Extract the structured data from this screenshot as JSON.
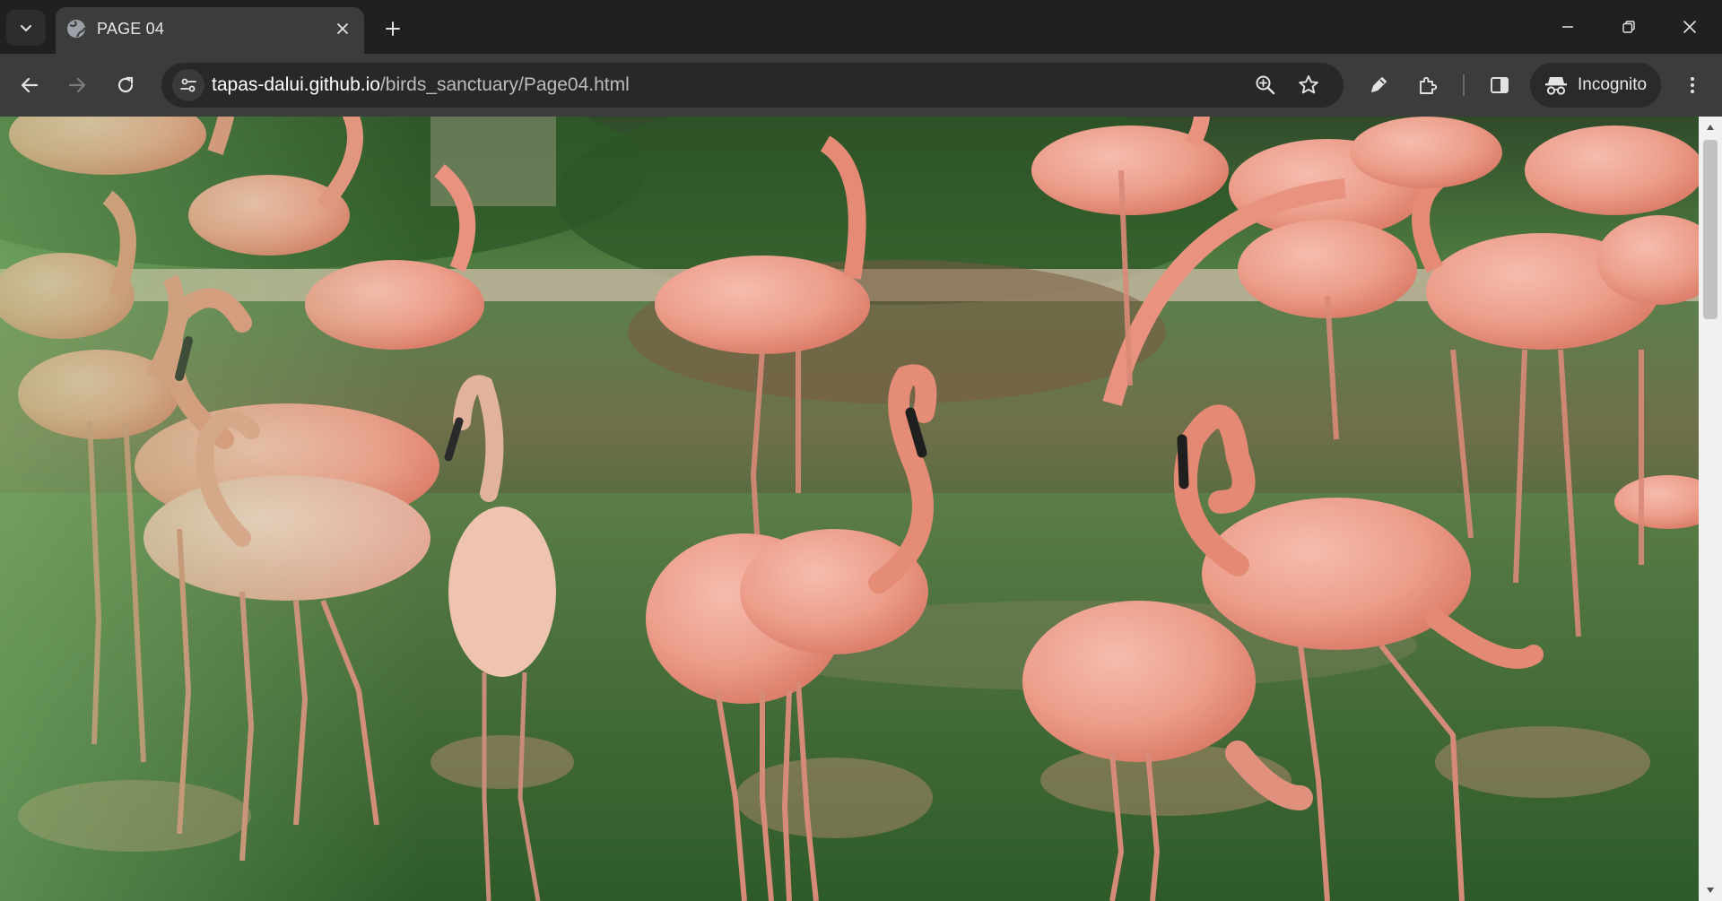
{
  "browser": {
    "tab": {
      "title": "PAGE 04"
    },
    "address_bar": {
      "host": "tapas-dalui.github.io",
      "path": "/birds_sanctuary/Page04.html"
    },
    "profile": {
      "label": "Incognito"
    }
  },
  "page": {
    "image_subject": "flamingos"
  }
}
